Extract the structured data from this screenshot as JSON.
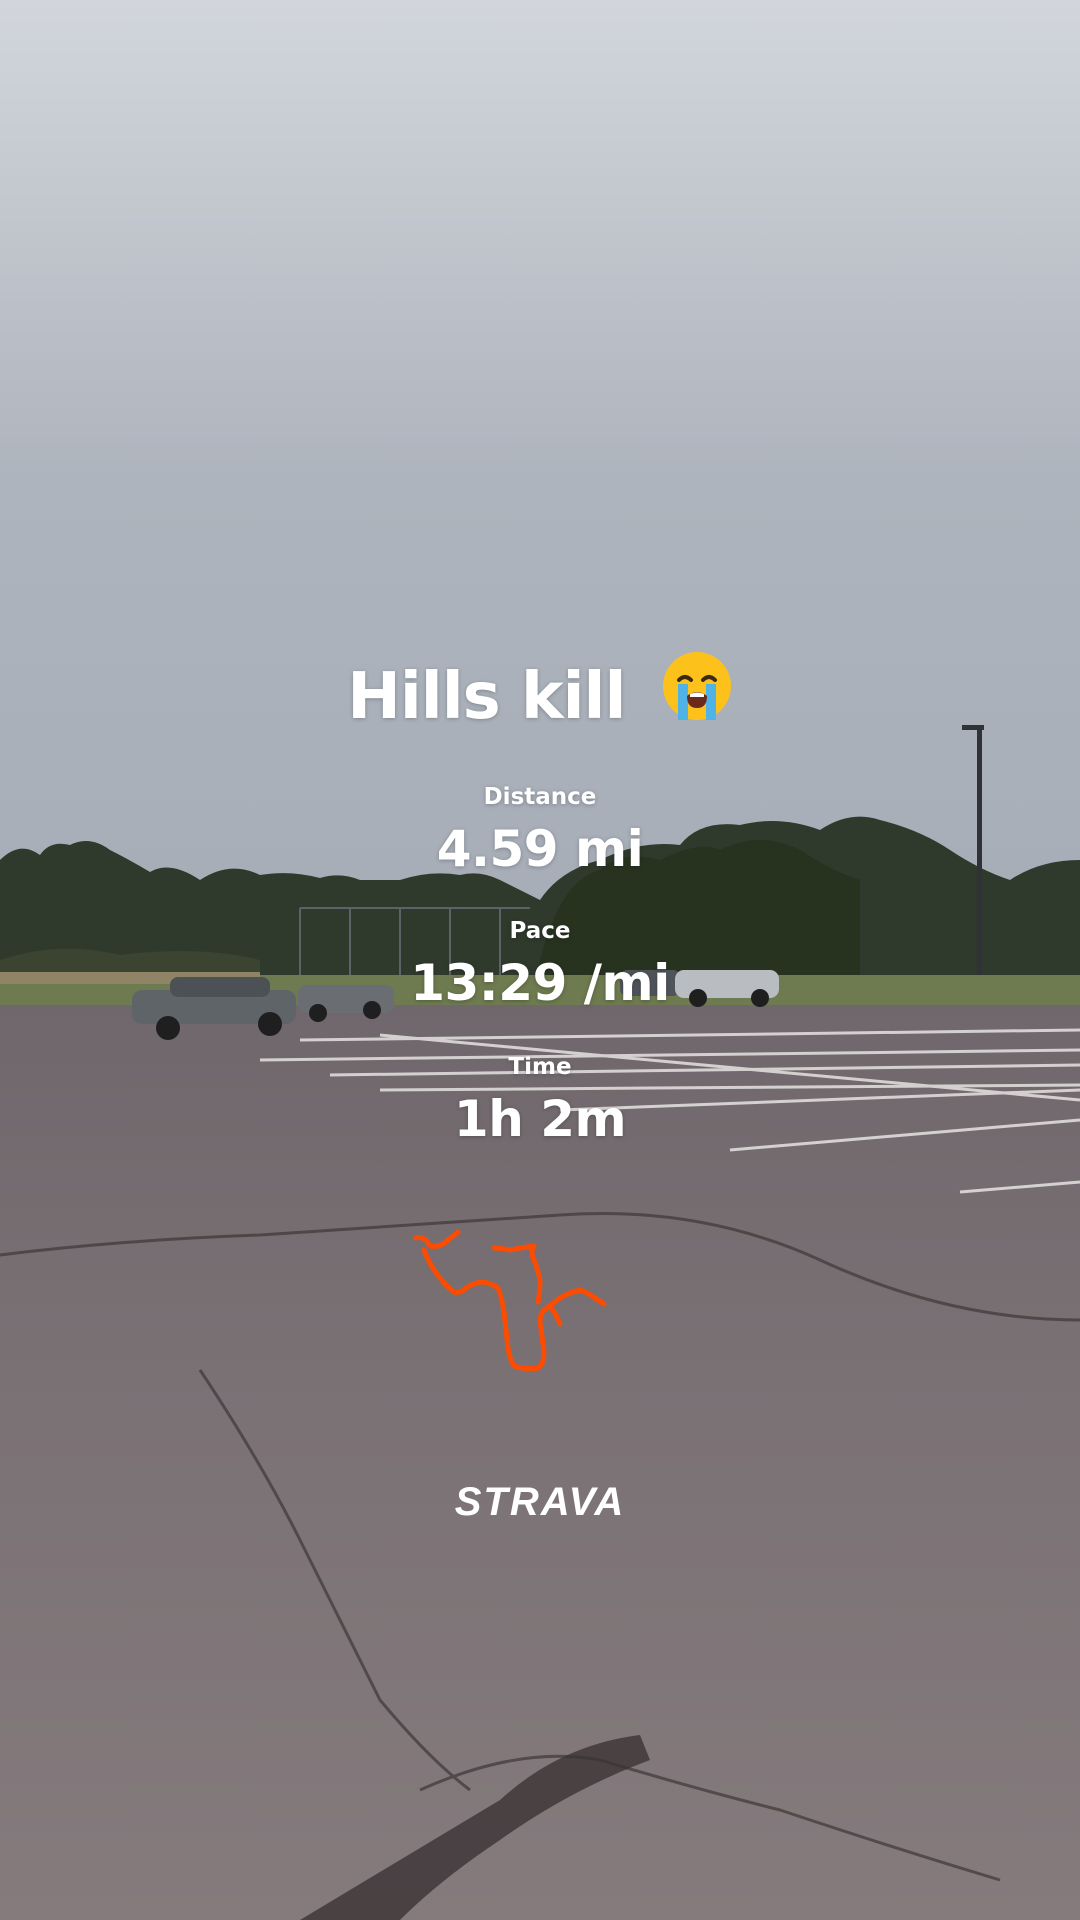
{
  "activity": {
    "title": "Hills kill",
    "emoji_icon": "loudly-crying-face-icon"
  },
  "stats": {
    "distance_label": "Distance",
    "distance_value": "4.59 mi",
    "pace_label": "Pace",
    "pace_value": "13:29 /mi",
    "time_label": "Time",
    "time_value": "1h 2m"
  },
  "route": {
    "color": "#fc4c02"
  },
  "brand": {
    "logo_text": "STRAVA"
  }
}
